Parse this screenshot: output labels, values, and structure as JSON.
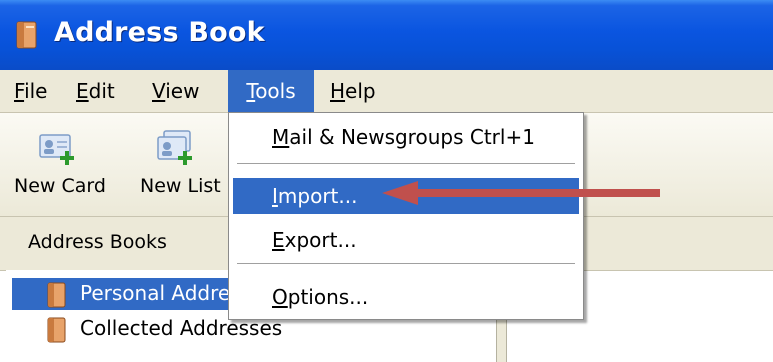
{
  "window": {
    "title": "Address Book"
  },
  "menubar": {
    "file": {
      "pre": "",
      "ul": "F",
      "post": "ile"
    },
    "edit": {
      "pre": "",
      "ul": "E",
      "post": "dit"
    },
    "view": {
      "pre": "",
      "ul": "V",
      "post": "iew"
    },
    "tools": {
      "pre": "",
      "ul": "T",
      "post": "ools"
    },
    "help": {
      "pre": "",
      "ul": "H",
      "post": "elp"
    }
  },
  "toolbar": {
    "new_card": "New Card",
    "new_list": "New List"
  },
  "left_pane": {
    "header": "Address Books",
    "books": [
      {
        "label": "Personal Addre"
      },
      {
        "label": "Collected Addresses"
      }
    ]
  },
  "tools_menu": {
    "mail_newsgroups": {
      "pre": "",
      "ul": "M",
      "post": "ail & Newsgroups Ctrl+1"
    },
    "import": {
      "pre": "",
      "ul": "I",
      "post": "mport..."
    },
    "export": {
      "pre": "",
      "ul": "E",
      "post": "xport..."
    },
    "options": {
      "pre": "",
      "ul": "O",
      "post": "ptions..."
    }
  },
  "colors": {
    "title_bar": "#0a55e0",
    "menu_highlight": "#316ac5",
    "chrome": "#ece9d8",
    "annotation_arrow": "#c0504d"
  },
  "icons": {
    "app": "address-book-icon",
    "new_card": "new-card-icon",
    "new_list": "new-list-icon",
    "book": "address-book-folder-icon"
  }
}
